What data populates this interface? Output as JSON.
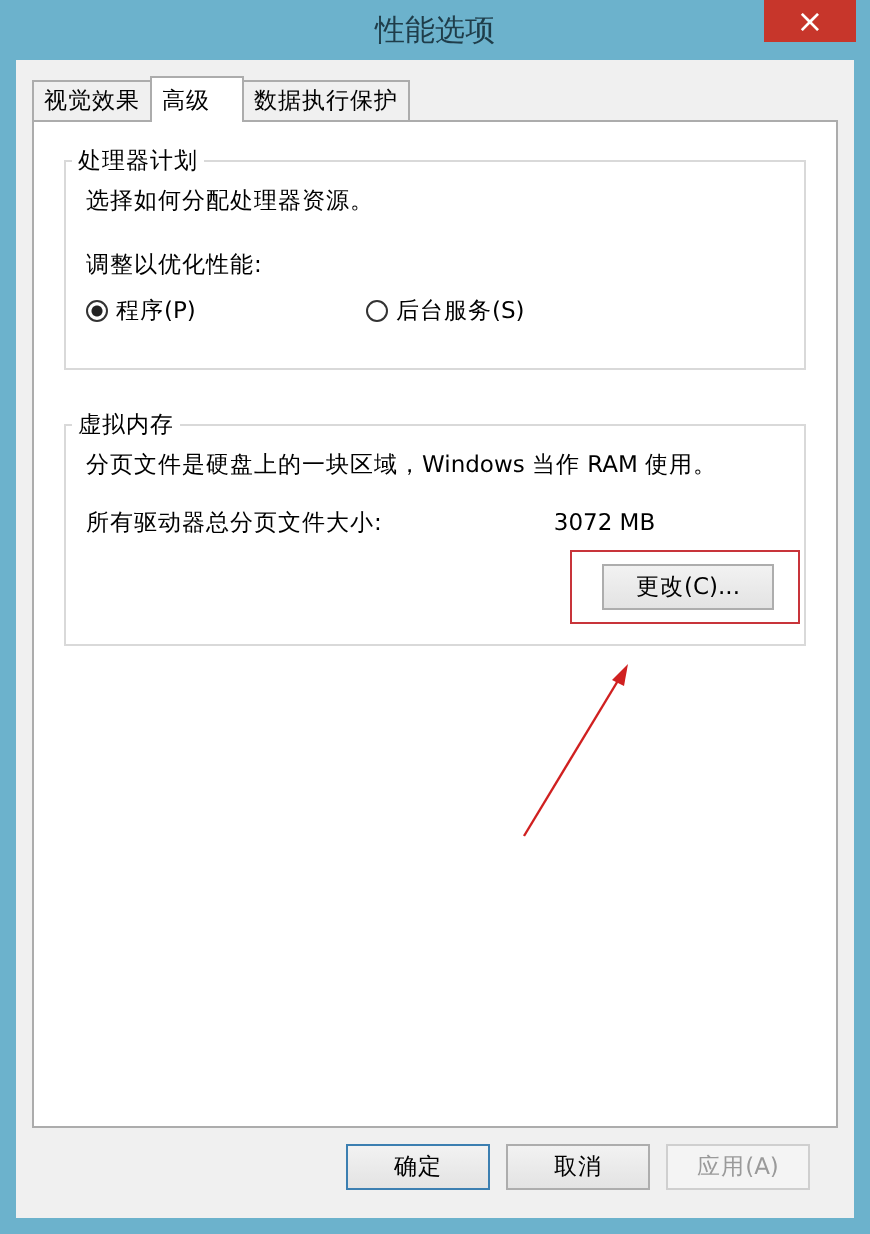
{
  "window": {
    "title": "性能选项",
    "close": "×"
  },
  "tabs": [
    {
      "label": "视觉效果",
      "selected": false
    },
    {
      "label": "高级",
      "selected": true
    },
    {
      "label": "数据执行保护",
      "selected": false
    }
  ],
  "processor": {
    "title": "处理器计划",
    "description": "选择如何分配处理器资源。",
    "prompt": "调整以优化性能:",
    "options": [
      {
        "label": "程序(P)",
        "selected": true
      },
      {
        "label": "后台服务(S)",
        "selected": false
      }
    ]
  },
  "virtual_memory": {
    "title": "虚拟内存",
    "description": "分页文件是硬盘上的一块区域，Windows 当作 RAM 使用。",
    "size_label": "所有驱动器总分页文件大小:",
    "size_value": "3072 MB",
    "change_button": "更改(C)..."
  },
  "buttons": [
    {
      "label": "确定",
      "default": true,
      "disabled": false
    },
    {
      "label": "取消",
      "default": false,
      "disabled": false
    },
    {
      "label": "应用(A)",
      "default": false,
      "disabled": true
    }
  ]
}
